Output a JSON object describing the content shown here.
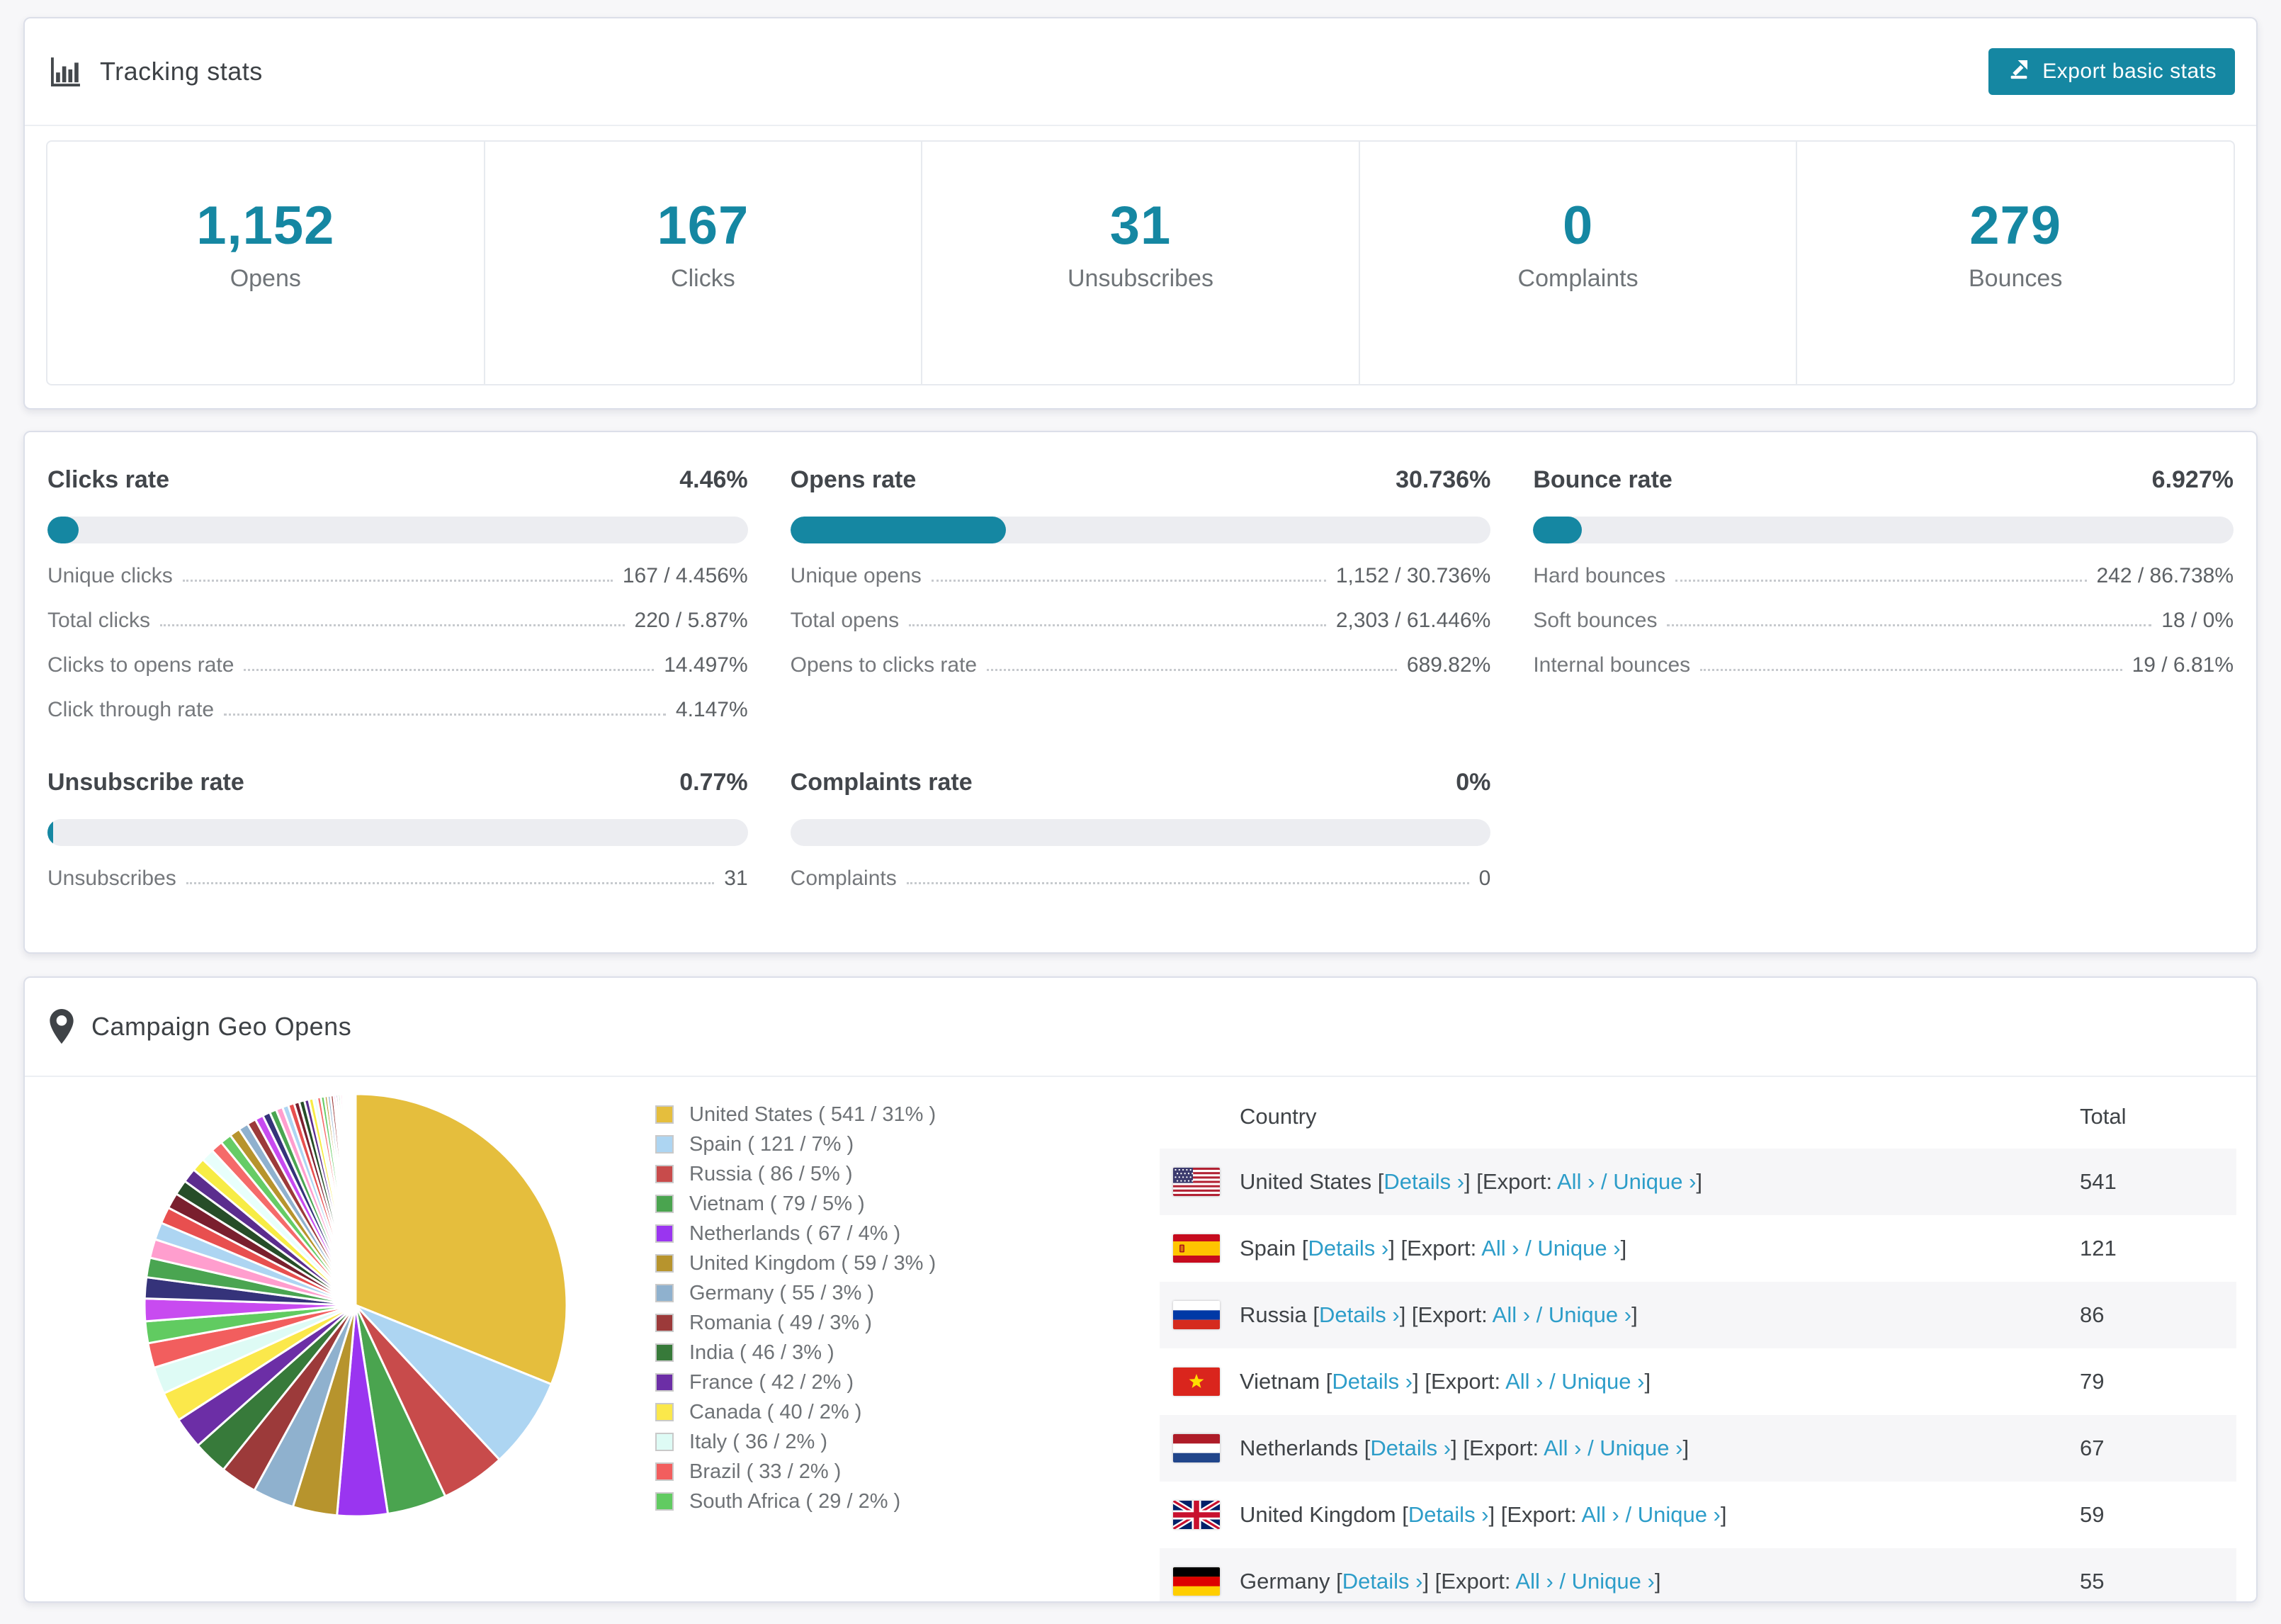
{
  "colors": {
    "accent_teal": "#1587a2",
    "link_blue": "#2d9dc9",
    "bar_track": "#ecedf1",
    "table_stripe": "#f6f6f8"
  },
  "tracking": {
    "title": "Tracking stats",
    "export_button": "Export basic stats",
    "stats": [
      {
        "value": "1,152",
        "label": "Opens"
      },
      {
        "value": "167",
        "label": "Clicks"
      },
      {
        "value": "31",
        "label": "Unsubscribes"
      },
      {
        "value": "0",
        "label": "Complaints"
      },
      {
        "value": "279",
        "label": "Bounces"
      }
    ]
  },
  "rates": [
    {
      "title": "Clicks rate",
      "value": "4.46%",
      "fill_pct": 4.46,
      "rows": [
        {
          "label": "Unique clicks",
          "value": "167 / 4.456%"
        },
        {
          "label": "Total clicks",
          "value": "220 / 5.87%"
        },
        {
          "label": "Clicks to opens rate",
          "value": "14.497%"
        },
        {
          "label": "Click through rate",
          "value": "4.147%"
        }
      ]
    },
    {
      "title": "Opens rate",
      "value": "30.736%",
      "fill_pct": 30.736,
      "rows": [
        {
          "label": "Unique opens",
          "value": "1,152 / 30.736%"
        },
        {
          "label": "Total opens",
          "value": "2,303 / 61.446%"
        },
        {
          "label": "Opens to clicks rate",
          "value": "689.82%"
        }
      ]
    },
    {
      "title": "Bounce rate",
      "value": "6.927%",
      "fill_pct": 6.927,
      "rows": [
        {
          "label": "Hard bounces",
          "value": "242 / 86.738%"
        },
        {
          "label": "Soft bounces",
          "value": "18 / 0%"
        },
        {
          "label": "Internal bounces",
          "value": "19 / 6.81%"
        }
      ]
    },
    {
      "title": "Unsubscribe rate",
      "value": "0.77%",
      "fill_pct": 0.77,
      "rows": [
        {
          "label": "Unsubscribes",
          "value": "31"
        }
      ]
    },
    {
      "title": "Complaints rate",
      "value": "0%",
      "fill_pct": 0,
      "rows": [
        {
          "label": "Complaints",
          "value": "0"
        }
      ]
    }
  ],
  "geo": {
    "title": "Campaign Geo Opens",
    "legend": [
      {
        "label": "United States ( 541 / 31% )",
        "color": "#e5be3d"
      },
      {
        "label": "Spain ( 121 / 7% )",
        "color": "#add5f2"
      },
      {
        "label": "Russia ( 86 / 5% )",
        "color": "#c84b4b"
      },
      {
        "label": "Vietnam ( 79 / 5% )",
        "color": "#4aa44f"
      },
      {
        "label": "Netherlands ( 67 / 4% )",
        "color": "#9a35f0"
      },
      {
        "label": "United Kingdom ( 59 / 3% )",
        "color": "#b7942d"
      },
      {
        "label": "Germany ( 55 / 3% )",
        "color": "#8fb1ce"
      },
      {
        "label": "Romania ( 49 / 3% )",
        "color": "#9c3a3a"
      },
      {
        "label": "India ( 46 / 3% )",
        "color": "#377a3a"
      },
      {
        "label": "France ( 42 / 2% )",
        "color": "#6c2ea6"
      },
      {
        "label": "Canada ( 40 / 2% )",
        "color": "#fbe84b"
      },
      {
        "label": "Italy ( 36 / 2% )",
        "color": "#defbf5"
      },
      {
        "label": "Brazil ( 33 / 2% )",
        "color": "#f25e5e"
      },
      {
        "label": "South Africa ( 29 / 2% )",
        "color": "#61cb61"
      }
    ],
    "table": {
      "col_country": "Country",
      "col_total": "Total",
      "details_label": "Details ›",
      "export_label": "Export:",
      "all_label": "All ›",
      "slash": "/",
      "unique_label": "Unique ›",
      "rows": [
        {
          "country": "United States",
          "flag": "us",
          "total": "541"
        },
        {
          "country": "Spain",
          "flag": "es",
          "total": "121"
        },
        {
          "country": "Russia",
          "flag": "ru",
          "total": "86"
        },
        {
          "country": "Vietnam",
          "flag": "vn",
          "total": "79"
        },
        {
          "country": "Netherlands",
          "flag": "nl",
          "total": "67"
        },
        {
          "country": "United Kingdom",
          "flag": "gb",
          "total": "59"
        },
        {
          "country": "Germany",
          "flag": "de",
          "total": "55"
        }
      ]
    }
  },
  "chart_data": {
    "type": "pie",
    "title": "Campaign Geo Opens",
    "legend_position": "right",
    "start_angle_deg": -90,
    "direction": "clockwise",
    "slices": [
      {
        "label": "United States",
        "value": 541,
        "pct": 31,
        "color": "#e5be3d"
      },
      {
        "label": "Spain",
        "value": 121,
        "pct": 7,
        "color": "#add5f2"
      },
      {
        "label": "Russia",
        "value": 86,
        "pct": 5,
        "color": "#c84b4b"
      },
      {
        "label": "Vietnam",
        "value": 79,
        "pct": 5,
        "color": "#4aa44f"
      },
      {
        "label": "Netherlands",
        "value": 67,
        "pct": 4,
        "color": "#9a35f0"
      },
      {
        "label": "United Kingdom",
        "value": 59,
        "pct": 3,
        "color": "#b7942d"
      },
      {
        "label": "Germany",
        "value": 55,
        "pct": 3,
        "color": "#8fb1ce"
      },
      {
        "label": "Romania",
        "value": 49,
        "pct": 3,
        "color": "#9c3a3a"
      },
      {
        "label": "India",
        "value": 46,
        "pct": 3,
        "color": "#377a3a"
      },
      {
        "label": "France",
        "value": 42,
        "pct": 2,
        "color": "#6c2ea6"
      },
      {
        "label": "Canada",
        "value": 40,
        "pct": 2,
        "color": "#fbe84b"
      },
      {
        "label": "Italy",
        "value": 36,
        "pct": 2,
        "color": "#defbf5"
      },
      {
        "label": "Brazil",
        "value": 33,
        "pct": 2,
        "color": "#f25e5e"
      },
      {
        "label": "South Africa",
        "value": 29,
        "pct": 2,
        "color": "#61cb61"
      }
    ],
    "unlabeled_tail_note": "long tail of small unlabeled country slices (~26% combined), estimated",
    "unlabeled_tail_values": [
      30,
      28,
      26,
      25,
      23,
      22,
      21,
      20,
      19,
      18,
      17,
      16,
      15,
      14,
      13,
      12,
      11,
      10,
      9,
      9,
      8,
      8,
      7,
      7,
      6,
      6,
      5,
      5,
      5,
      4,
      4,
      4,
      3,
      3,
      3,
      3,
      2,
      2,
      2,
      2,
      2,
      1,
      1,
      1,
      1,
      1,
      1,
      1
    ],
    "tail_palette": [
      "#c84bf0",
      "#35337a",
      "#4aa551",
      "#ff9ece",
      "#add5f2",
      "#e84f4f",
      "#7a1f2e",
      "#264d28",
      "#5b2d8e",
      "#f7ec45",
      "#e8fffb",
      "#f56a6a",
      "#66cc66",
      "#b7942d",
      "#8fb1ce",
      "#9c3a3a"
    ]
  }
}
